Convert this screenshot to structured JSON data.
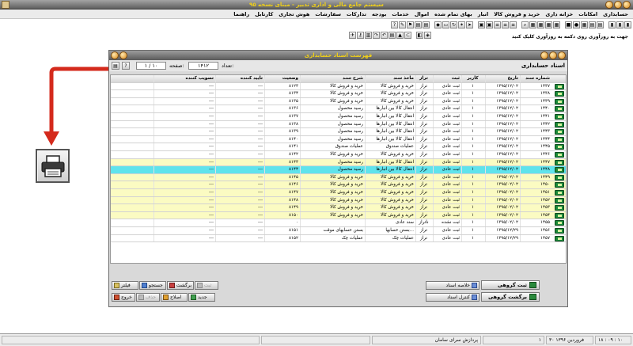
{
  "app": {
    "title": "سیستم جامع مالی و اداری تدبیر - مبنای نسخه ۹۵"
  },
  "menu": [
    "حسابداری",
    "امکانات",
    "خزانه داری",
    "خرید و فروش کالا",
    "انبار",
    "بهای تمام شده",
    "اموال",
    "خدمات",
    "بودجه",
    "تدارکات",
    "سفارشات",
    "هوش تجاری",
    "کارتابل",
    "راهنما"
  ],
  "toolbar_hint": "جهت به روزآوری روی دکمه به روزآوری کلیک کنید",
  "doc_window": {
    "title": "فهرست اسناد حسابداری",
    "section_label": "اسناد حسابداری",
    "count_label": "تعداد:",
    "count_value": "۱۴۱۲",
    "page_label": "صفحه:",
    "page_value": "۱ / ۱۰"
  },
  "grid": {
    "columns": [
      "شماره سند",
      "تاریخ",
      "کاربر",
      "ثبت",
      "تراز",
      "ماخذ سند",
      "شرح سند",
      "وضعیت",
      "تایید کننده",
      "تصویب کننده"
    ],
    "rows": [
      {
        "no": "۱۴۳۷",
        "date": "۱۳۹۵/۱۲/۰۲",
        "user": "۱",
        "status": "ثبت عادی",
        "balance": "تراز",
        "source": "خرید و فروش کالا",
        "desc": "خرید و فروش کالا",
        "state": "۸۱۲۳",
        "approver": "---",
        "ratifier": "---",
        "hl": ""
      },
      {
        "no": "۱۴۳۸",
        "date": "۱۳۹۵/۱۲/۰۲",
        "user": "۱",
        "status": "ثبت عادی",
        "balance": "تراز",
        "source": "خرید و فروش کالا",
        "desc": "خرید و فروش کالا",
        "state": "۸۱۳۴",
        "approver": "---",
        "ratifier": "---",
        "hl": ""
      },
      {
        "no": "۱۴۳۹",
        "date": "۱۳۹۵/۱۲/۰۲",
        "user": "۱",
        "status": "ثبت عادی",
        "balance": "تراز",
        "source": "خرید و فروش کالا",
        "desc": "خرید و فروش کالا",
        "state": "۸۱۳۵",
        "approver": "---",
        "ratifier": "---",
        "hl": ""
      },
      {
        "no": "۱۴۴۰",
        "date": "۱۳۹۵/۱۲/۰۲",
        "user": "۱",
        "status": "ثبت عادی",
        "balance": "تراز",
        "source": "انتقال کالا بین انبارها",
        "desc": "رسید محصول",
        "state": "۸۱۳۶",
        "approver": "---",
        "ratifier": "---",
        "hl": ""
      },
      {
        "no": "۱۴۴۱",
        "date": "۱۳۹۵/۱۲/۰۲",
        "user": "۱",
        "status": "ثبت عادی",
        "balance": "تراز",
        "source": "انتقال کالا بین انبارها",
        "desc": "رسید محصول",
        "state": "۸۱۳۷",
        "approver": "---",
        "ratifier": "---",
        "hl": ""
      },
      {
        "no": "۱۴۴۲",
        "date": "۱۳۹۵/۱۲/۰۲",
        "user": "۱",
        "status": "ثبت عادی",
        "balance": "تراز",
        "source": "انتقال کالا بین انبارها",
        "desc": "رسید محصول",
        "state": "۸۱۳۸",
        "approver": "---",
        "ratifier": "---",
        "hl": ""
      },
      {
        "no": "۱۴۴۳",
        "date": "۱۳۹۵/۱۲/۰۲",
        "user": "۱",
        "status": "ثبت عادی",
        "balance": "تراز",
        "source": "انتقال کالا بین انبارها",
        "desc": "رسید محصول",
        "state": "۸۱۳۹",
        "approver": "---",
        "ratifier": "---",
        "hl": ""
      },
      {
        "no": "۱۴۴۴",
        "date": "۱۳۹۵/۱۲/۰۲",
        "user": "۱",
        "status": "ثبت عادی",
        "balance": "تراز",
        "source": "انتقال کالا بین انبارها",
        "desc": "رسید محصول",
        "state": "۸۱۴۰",
        "approver": "---",
        "ratifier": "---",
        "hl": ""
      },
      {
        "no": "۱۴۴۵",
        "date": "۱۳۹۵/۱۲/۰۲",
        "user": "۱",
        "status": "ثبت عادی",
        "balance": "تراز",
        "source": "عملیات صندوق",
        "desc": "عملیات صندوق",
        "state": "۸۱۴۱",
        "approver": "---",
        "ratifier": "---",
        "hl": ""
      },
      {
        "no": "۱۴۴۶",
        "date": "۱۳۹۵/۱۲/۰۲",
        "user": "۱",
        "status": "ثبت عادی",
        "balance": "تراز",
        "source": "خرید و فروش کالا",
        "desc": "خرید و فروش کالا",
        "state": "۸۱۴۲",
        "approver": "---",
        "ratifier": "---",
        "hl": ""
      },
      {
        "no": "۱۴۴۷",
        "date": "۱۳۹۵/۱۲/۰۲",
        "user": "۱",
        "status": "ثبت عادی",
        "balance": "تراز",
        "source": "انتقال کالا بین انبارها",
        "desc": "رسید محصول",
        "state": "۸۱۴۳",
        "approver": "---",
        "ratifier": "---",
        "hl": "yellow"
      },
      {
        "no": "۱۴۴۸",
        "date": "۱۳۹۵/۱۲/۰۲",
        "user": "۱",
        "status": "ثبت عادی",
        "balance": "تراز",
        "source": "انتقال کالا بین انبارها",
        "desc": "رسید محصول",
        "state": "۸۱۴۴",
        "approver": "---",
        "ratifier": "---",
        "hl": "cyan"
      },
      {
        "no": "۱۴۴۹",
        "date": "۱۳۹۵/۰۲/۰۲",
        "user": "۱",
        "status": "ثبت عادی",
        "balance": "تراز",
        "source": "خرید و فروش کالا",
        "desc": "خرید و فروش کالا",
        "state": "۸۱۴۵",
        "approver": "---",
        "ratifier": "---",
        "hl": "yellow"
      },
      {
        "no": "۱۴۵۰",
        "date": "۱۳۹۵/۰۲/۰۲",
        "user": "۱",
        "status": "ثبت عادی",
        "balance": "تراز",
        "source": "خرید و فروش کالا",
        "desc": "خرید و فروش کالا",
        "state": "۸۱۴۶",
        "approver": "---",
        "ratifier": "---",
        "hl": "yellow"
      },
      {
        "no": "۱۴۵۱",
        "date": "۱۳۹۵/۰۲/۰۲",
        "user": "۱",
        "status": "ثبت عادی",
        "balance": "تراز",
        "source": "خرید و فروش کالا",
        "desc": "خرید و فروش کالا",
        "state": "۸۱۴۷",
        "approver": "---",
        "ratifier": "---",
        "hl": "yellow"
      },
      {
        "no": "۱۴۵۲",
        "date": "۱۳۹۵/۰۲/۰۲",
        "user": "۱",
        "status": "ثبت عادی",
        "balance": "تراز",
        "source": "خرید و فروش کالا",
        "desc": "خرید و فروش کالا",
        "state": "۸۱۴۸",
        "approver": "---",
        "ratifier": "---",
        "hl": "yellow"
      },
      {
        "no": "۱۴۵۳",
        "date": "۱۳۹۵/۰۲/۰۲",
        "user": "۱",
        "status": "ثبت عادی",
        "balance": "تراز",
        "source": "خرید و فروش کالا",
        "desc": "خرید و فروش کالا",
        "state": "۸۱۴۹",
        "approver": "---",
        "ratifier": "---",
        "hl": "yellow"
      },
      {
        "no": "۱۴۵۴",
        "date": "۱۳۹۵/۰۲/۰۲",
        "user": "۱",
        "status": "ثبت عادی",
        "balance": "تراز",
        "source": "خرید و فروش کالا",
        "desc": "خرید و فروش کالا",
        "state": "۸۱۵۰",
        "approver": "---",
        "ratifier": "---",
        "hl": "yellow"
      },
      {
        "no": "۱۴۵۵",
        "date": "۱۳۹۵/۰۲/۰۲",
        "user": "۱",
        "status": "ثبت نشده",
        "balance": "ناتراز",
        "source": "سند عادی",
        "desc": "",
        "state": "۰",
        "approver": "---",
        "ratifier": "---",
        "hl": ""
      },
      {
        "no": "۱۴۵۶",
        "date": "۱۳۹۵/۱۲/۲۹",
        "user": "۱",
        "status": "ثبت عادی",
        "balance": "تراز",
        "source": "بستن حسابها...",
        "desc": "بستن حسابهای موقت",
        "state": "۸۱۵۱",
        "approver": "---",
        "ratifier": "---",
        "hl": ""
      },
      {
        "no": "۱۴۵۷",
        "date": "۱۳۹۵/۱۲/۲۹",
        "user": "۱",
        "status": "ثبت عادی",
        "balance": "تراز",
        "source": "عملیات چک",
        "desc": "عملیات چک",
        "state": "۸۱۵۲",
        "approver": "---",
        "ratifier": "---",
        "hl": ""
      }
    ]
  },
  "buttons": {
    "summary": "خلاصه اسناد",
    "register_group": "ثبت گروهی",
    "control": "کنترل اسناد",
    "return_group": "برگشت گروهی",
    "filter": "فیلتر",
    "search": "جستجو",
    "return": "برگشت",
    "register": "ثبت",
    "exit": "خروج",
    "edit": "اصلاح",
    "new": "جدید",
    "delete": "حذف"
  },
  "status": {
    "time": "۱۸ : ۰۹ : ۱۰",
    "date": "۳۰ فروردین ۱۳۹۶",
    "user": "۱",
    "company": "پردازش سرای سامان"
  },
  "colors": {
    "title_text": "#f0d018",
    "row_yellow": "#fbfbc2",
    "row_cyan": "#5fe3ec",
    "arrow_red": "#d42a1c"
  }
}
